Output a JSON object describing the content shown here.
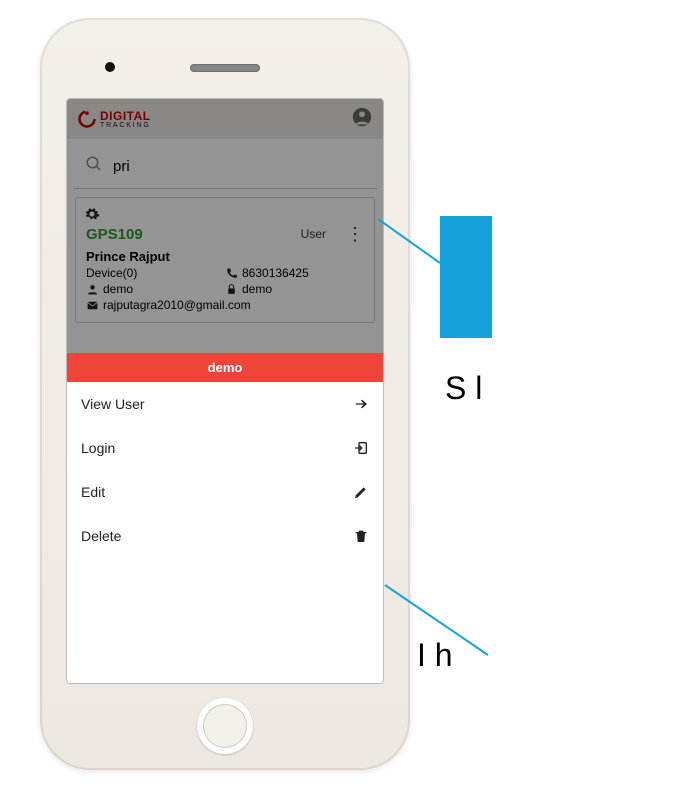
{
  "header": {
    "logo_line1": "DIGITAL",
    "logo_line2": "TRACKING"
  },
  "search": {
    "value": "pri"
  },
  "user_card": {
    "device_name": "GPS109",
    "role": "User",
    "owner": "Prince Rajput",
    "device_count": "Device(0)",
    "phone": "8630136425",
    "username": "demo",
    "password": "demo",
    "email": "rajputagra2010@gmail.com"
  },
  "sheet": {
    "title": "demo",
    "items": {
      "view": "View User",
      "login": "Login",
      "edit": "Edit",
      "delete": "Delete"
    }
  },
  "callouts": {
    "top": "S                l",
    "bottom": "I                               h"
  }
}
